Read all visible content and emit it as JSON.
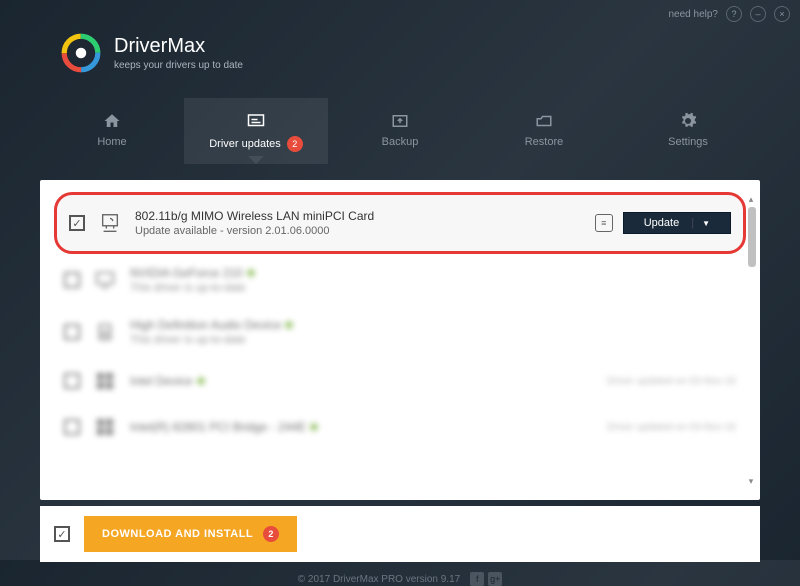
{
  "topbar": {
    "help_text": "need help?",
    "help_icon": "?",
    "minimize": "–",
    "close": "×"
  },
  "header": {
    "app_name": "DriverMax",
    "tagline": "keeps your drivers up to date"
  },
  "nav": {
    "home": "Home",
    "driver_updates": "Driver updates",
    "updates_count": "2",
    "backup": "Backup",
    "restore": "Restore",
    "settings": "Settings"
  },
  "drivers": {
    "highlighted": {
      "name": "802.11b/g MIMO Wireless LAN miniPCI Card",
      "status": "Update available - version 2.01.06.0000",
      "update_label": "Update"
    },
    "items": [
      {
        "name": "NVIDIA GeForce 210",
        "status": "This driver is up-to-date"
      },
      {
        "name": "High Definition Audio Device",
        "status": "This driver is up-to-date"
      },
      {
        "name": "Intel Device",
        "status": "",
        "right_text": "Driver updated on 03-Nov-16"
      },
      {
        "name": "Intel(R) 82801 PCI Bridge - 244E",
        "status": "",
        "right_text": "Driver updated on 03-Nov-16"
      }
    ]
  },
  "bottom": {
    "download_label": "DOWNLOAD AND INSTALL",
    "download_count": "2"
  },
  "footer": {
    "copyright": "© 2017 DriverMax PRO version 9.17"
  }
}
